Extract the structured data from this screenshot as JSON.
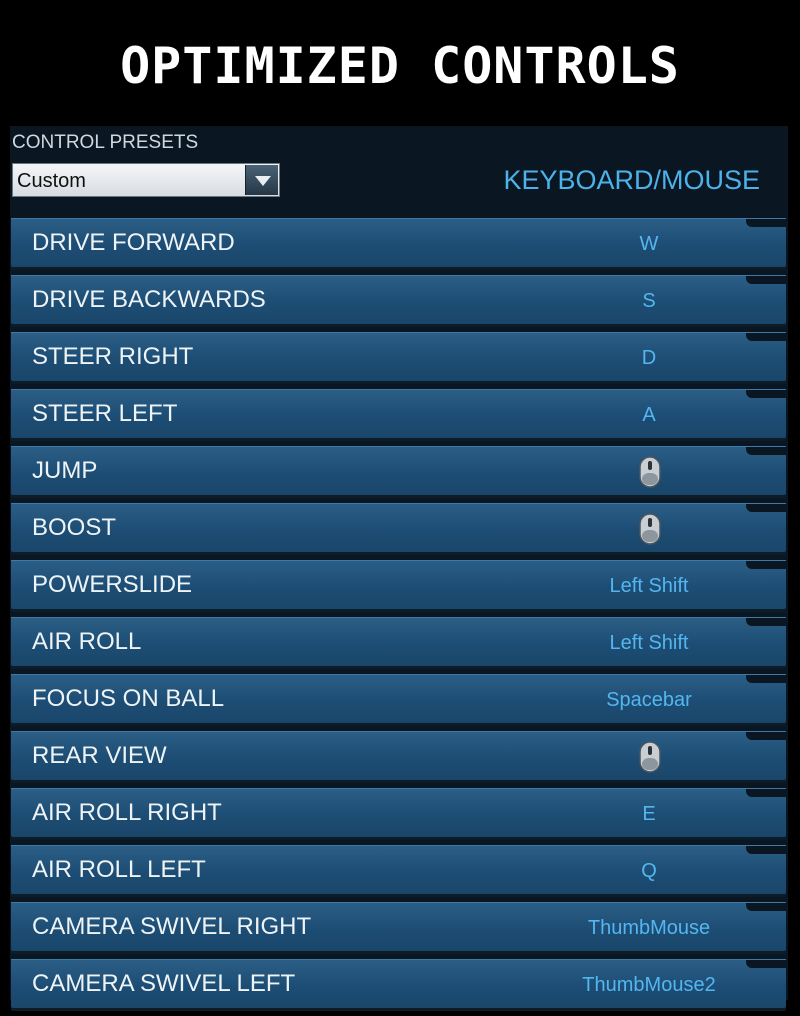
{
  "title": "OPTIMIZED CONTROLS",
  "presets": {
    "label": "CONTROL PRESETS",
    "selected": "Custom"
  },
  "mode": "KEYBOARD/MOUSE",
  "bindings": [
    {
      "action": "DRIVE FORWARD",
      "key": "W",
      "icon": null
    },
    {
      "action": "DRIVE BACKWARDS",
      "key": "S",
      "icon": null
    },
    {
      "action": "STEER RIGHT",
      "key": "D",
      "icon": null
    },
    {
      "action": "STEER LEFT",
      "key": "A",
      "icon": null
    },
    {
      "action": "JUMP",
      "key": "",
      "icon": "mouse-right-button-icon"
    },
    {
      "action": "BOOST",
      "key": "",
      "icon": "mouse-left-button-icon"
    },
    {
      "action": "POWERSLIDE",
      "key": "Left Shift",
      "icon": null
    },
    {
      "action": "AIR ROLL",
      "key": "Left Shift",
      "icon": null
    },
    {
      "action": "FOCUS ON BALL",
      "key": "Spacebar",
      "icon": null
    },
    {
      "action": "REAR VIEW",
      "key": "",
      "icon": "mouse-middle-button-icon"
    },
    {
      "action": "AIR ROLL RIGHT",
      "key": "E",
      "icon": null
    },
    {
      "action": "AIR ROLL LEFT",
      "key": "Q",
      "icon": null
    },
    {
      "action": "CAMERA SWIVEL RIGHT",
      "key": "ThumbMouse",
      "icon": null
    },
    {
      "action": "CAMERA SWIVEL LEFT",
      "key": "ThumbMouse2",
      "icon": null
    }
  ],
  "colors": {
    "accent": "#4cb2ea",
    "row": "#1d4d74",
    "background": "#0a1621"
  }
}
